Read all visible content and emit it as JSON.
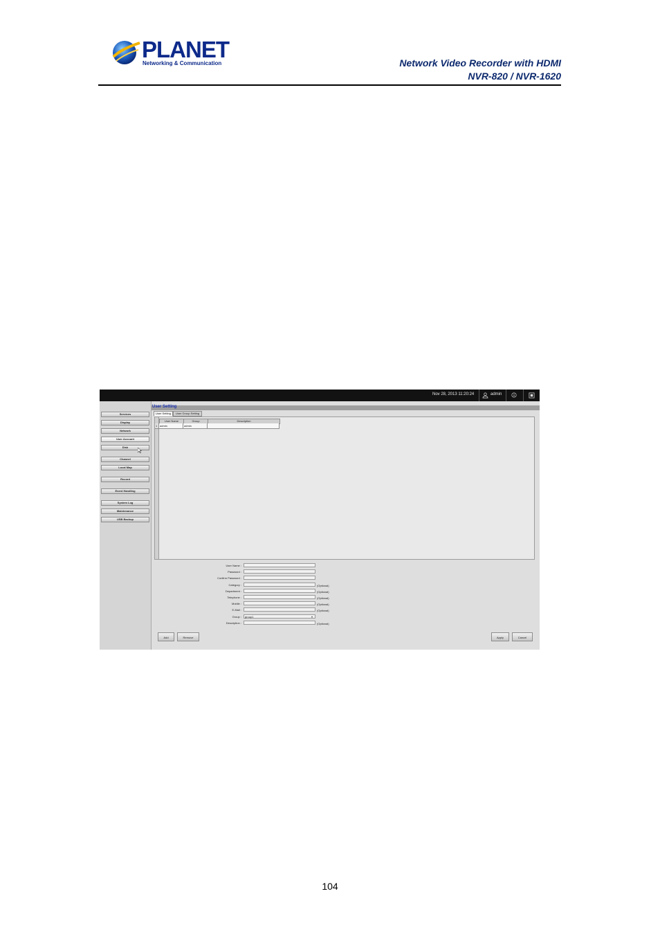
{
  "header": {
    "logo_name": "PLANET",
    "logo_tagline": "Networking & Communication",
    "title_line1": "Network Video Recorder with HDMI",
    "title_line2": "NVR-820 / NVR-1620"
  },
  "footer": {
    "page_number": "104"
  },
  "screenshot": {
    "topbar": {
      "datetime": "Nov 28, 2013 11:20:24",
      "user": "admin"
    },
    "sidebar": [
      "Services",
      "Display",
      "Network",
      "User Account",
      "Disk",
      "Channel",
      "Local Map",
      "Record",
      "Event Handling",
      "System Log",
      "Maintenance",
      "USB Backup"
    ],
    "active_menu": "User Account",
    "section_title": "User Setting",
    "tabs": [
      "User Setting",
      "User Group Setting"
    ],
    "table": {
      "columns": [
        "User Name",
        "Group",
        "Description"
      ],
      "rows": [
        {
          "index": "1",
          "user_name": "admin",
          "group": "admin",
          "description": ""
        }
      ]
    },
    "form": {
      "fields": [
        {
          "label": "User Name :",
          "value": "",
          "optional": ""
        },
        {
          "label": "Password :",
          "value": "",
          "optional": ""
        },
        {
          "label": "Confirm Password :",
          "value": "",
          "optional": ""
        },
        {
          "label": "Category :",
          "value": "",
          "optional": "(Optional)"
        },
        {
          "label": "Department :",
          "value": "",
          "optional": "(Optional)"
        },
        {
          "label": "Telephone :",
          "value": "",
          "optional": "(Optional)"
        },
        {
          "label": "Mobile :",
          "value": "",
          "optional": "(Optional)"
        },
        {
          "label": "E-Mail :",
          "value": "",
          "optional": "(Optional)"
        },
        {
          "label": "Group :",
          "value": "group1",
          "optional": ""
        },
        {
          "label": "Description :",
          "value": "",
          "optional": "(Optional)"
        }
      ]
    },
    "buttons": {
      "add": "Add",
      "remove": "Remove",
      "apply": "Apply",
      "cancel": "Cancel"
    }
  }
}
